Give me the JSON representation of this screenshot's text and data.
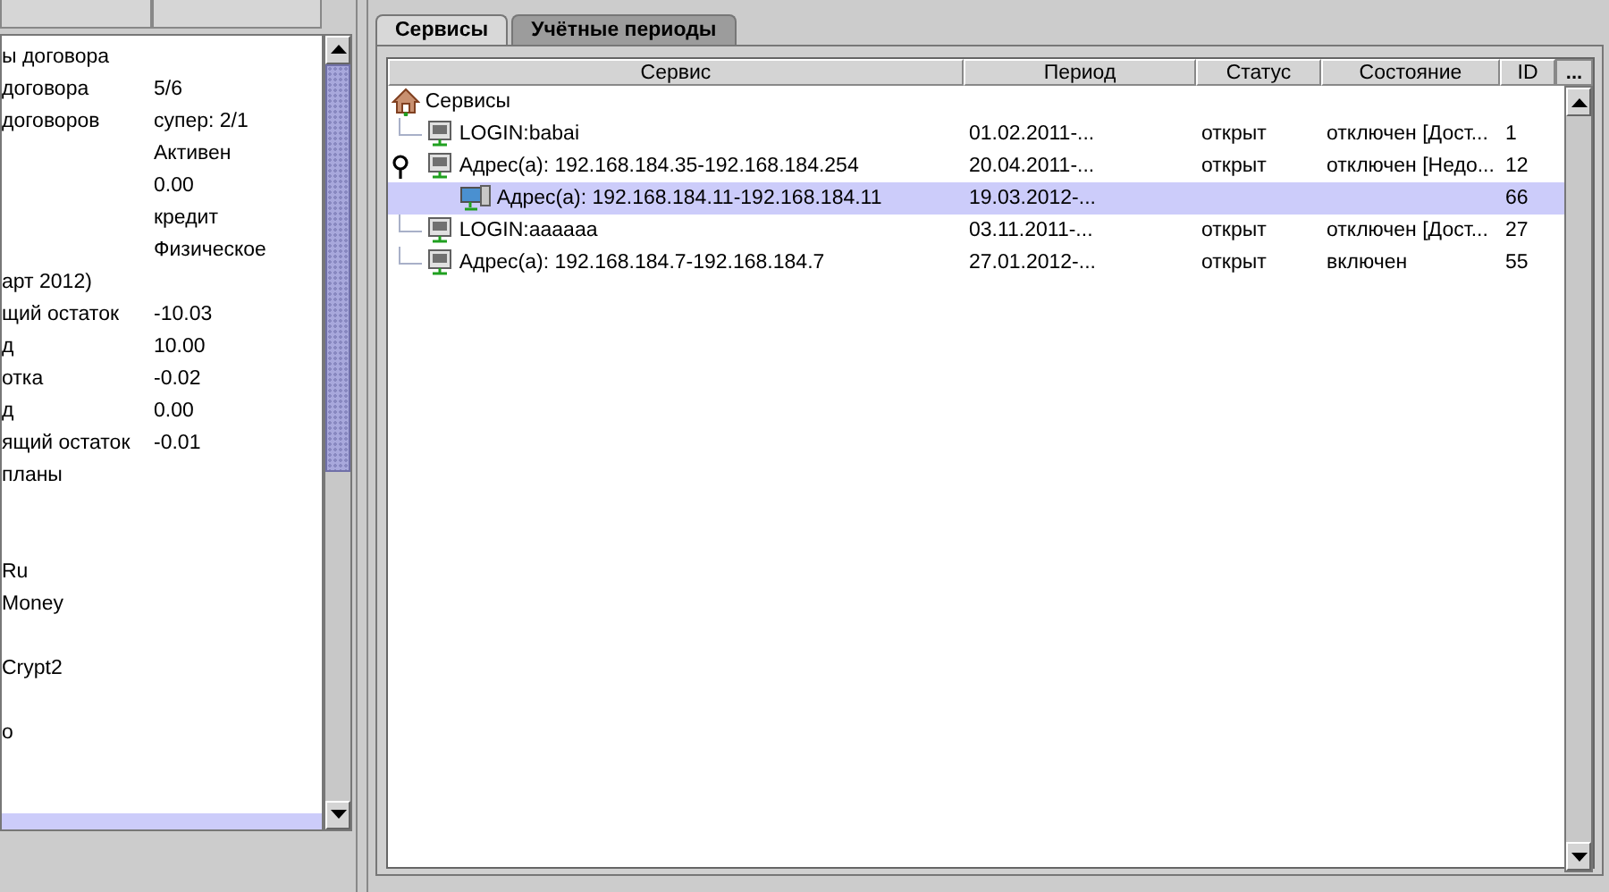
{
  "left_panel": {
    "rows": [
      {
        "label": "ы договора",
        "value": "",
        "selected": false
      },
      {
        "label": "договора",
        "value": "5/6",
        "selected": false
      },
      {
        "label": "договоров",
        "value": "супер: 2/1",
        "selected": false
      },
      {
        "label": "",
        "value": "Активен",
        "selected": false
      },
      {
        "label": "",
        "value": "0.00",
        "selected": false
      },
      {
        "label": "",
        "value": "кредит",
        "selected": false
      },
      {
        "label": "",
        "value": "Физическое",
        "selected": false
      },
      {
        "label": "арт 2012)",
        "value": "",
        "selected": false
      },
      {
        "label": "щий остаток",
        "value": "-10.03",
        "selected": false
      },
      {
        "label": "д",
        "value": "10.00",
        "selected": false
      },
      {
        "label": "отка",
        "value": "-0.02",
        "selected": false
      },
      {
        "label": "д",
        "value": "0.00",
        "selected": false
      },
      {
        "label": "ящий остаток",
        "value": "-0.01",
        "selected": false
      },
      {
        "label": "планы",
        "value": "",
        "selected": false
      },
      {
        "label": "",
        "value": "",
        "selected": false
      },
      {
        "label": "",
        "value": "",
        "selected": false
      },
      {
        "label": "Ru",
        "value": "",
        "selected": false
      },
      {
        "label": "Money",
        "value": "",
        "selected": false
      },
      {
        "label": "",
        "value": "",
        "selected": false
      },
      {
        "label": "Crypt2",
        "value": "",
        "selected": false
      },
      {
        "label": "",
        "value": "",
        "selected": false
      },
      {
        "label": "о",
        "value": "",
        "selected": false
      },
      {
        "label": "",
        "value": "",
        "selected": false
      },
      {
        "label": "",
        "value": "",
        "selected": false
      },
      {
        "label": "",
        "value": "",
        "selected": true
      }
    ]
  },
  "tabs": [
    {
      "label": "Сервисы",
      "selected": true
    },
    {
      "label": "Учётные периоды",
      "selected": false
    }
  ],
  "table": {
    "columns": [
      "Сервис",
      "Период",
      "Статус",
      "Состояние",
      "ID"
    ],
    "corner_button": "...",
    "tree": {
      "label": "Сервисы",
      "kind": "root",
      "selected": false,
      "children": [
        {
          "service": "LOGIN:babai",
          "period": "01.02.2011-...",
          "status": "открыт",
          "state": "отключен [Дост...",
          "id": "1",
          "kind": "network",
          "selected": false
        },
        {
          "service": "Адрес(а): 192.168.184.35-192.168.184.254",
          "period": "20.04.2011-...",
          "status": "открыт",
          "state": "отключен [Недо...",
          "id": "12",
          "kind": "network",
          "selected": false,
          "expanded": true,
          "children": [
            {
              "service": "Адрес(а): 192.168.184.11-192.168.184.11",
              "period": "19.03.2012-...",
              "id": "66",
              "kind": "computer",
              "selected": true
            }
          ]
        },
        {
          "service": "LOGIN:aaaaaa",
          "period": "03.11.2011-...",
          "status": "открыт",
          "state": "отключен [Дост...",
          "id": "27",
          "kind": "network",
          "selected": false
        },
        {
          "service": "Адрес(а): 192.168.184.7-192.168.184.7",
          "period": "27.01.2012-...",
          "status": "открыт",
          "state": "включен",
          "id": "55",
          "kind": "network",
          "selected": false
        }
      ]
    }
  }
}
